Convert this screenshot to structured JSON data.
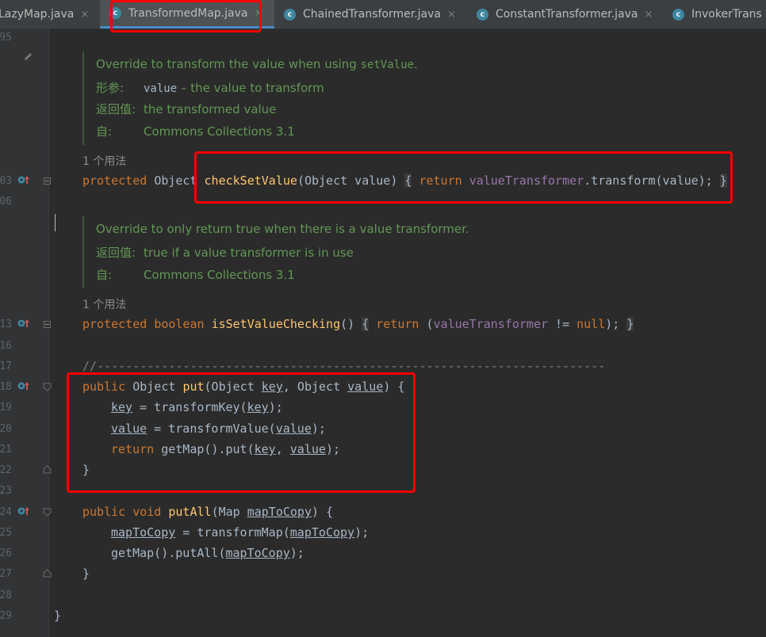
{
  "tabs": [
    {
      "label": "LazyMap.java",
      "icon": "class-icon",
      "active": false
    },
    {
      "label": "TransformedMap.java",
      "icon": "class-icon",
      "active": true
    },
    {
      "label": "ChainedTransformer.java",
      "icon": "class-icon",
      "active": false
    },
    {
      "label": "ConstantTransformer.java",
      "icon": "class-icon",
      "active": false
    },
    {
      "label": "InvokerTrans",
      "icon": "class-icon",
      "active": false
    }
  ],
  "tab_close_glyph": "×",
  "tab_class_glyph": "c",
  "line_numbers": {
    "l95": "95",
    "l103": "03",
    "l106": "06",
    "l113": "13",
    "l116": "16",
    "l117": "17",
    "l118": "18",
    "l119": "19",
    "l120": "20",
    "l121": "21",
    "l122": "22",
    "l123": "23",
    "l124": "24",
    "l125": "25",
    "l126": "26",
    "l127": "27",
    "l128": "28",
    "l129": "29"
  },
  "doc1": {
    "summary_prefix": "Override to transform the value when using ",
    "summary_code": "setValue",
    "summary_suffix": ".",
    "param_tag": "形参:",
    "param_name": "value",
    "param_desc": " – the value to transform",
    "return_tag": "返回值:",
    "return_desc": "the transformed value",
    "since_tag": "自:",
    "since_desc": "Commons Collections 3.1"
  },
  "doc2": {
    "summary": "Override to only return true when there is a value transformer.",
    "return_tag": "返回值:",
    "return_desc": "true if a value transformer is in use",
    "since_tag": "自:",
    "since_desc": "Commons Collections 3.1"
  },
  "usage_hint": "1 个用法",
  "code": {
    "checkSetValue": {
      "kw_protected": "protected",
      "type": "Object",
      "method": "checkSetValue",
      "params": "(Object value)",
      "open": "{",
      "kw_return": "return",
      "field": "valueTransformer",
      "call": ".transform(value);",
      "close": "}"
    },
    "isSetValueChecking": {
      "kw_protected": "protected",
      "kw_boolean": "boolean",
      "method": "isSetValueChecking",
      "parens": "()",
      "open": "{",
      "kw_return": "return",
      "paren_open": "(",
      "field": "valueTransformer",
      "op": " != ",
      "kw_null": "null",
      "tail": ");",
      "close": "}"
    },
    "separator": "//-----------------------------------------------------------------------",
    "put": {
      "kw_public": "public",
      "type": "Object",
      "method": "put",
      "p_open": "(Object ",
      "key": "key",
      "comma": ", Object ",
      "value": "value",
      "p_close": ") {",
      "l1_eq": " = transformKey(",
      "l1_end": ");",
      "l2_eq": " = transformValue(",
      "l2_end": ");",
      "kw_return": "return",
      "l3_call": " getMap().put(",
      "l3_sep": ", ",
      "l3_end": ");",
      "close": "}"
    },
    "putAll": {
      "kw_public": "public",
      "kw_void": "void",
      "method": "putAll",
      "p_open": "(Map ",
      "param": "mapToCopy",
      "p_close": ") {",
      "l1_eq": " = transformMap(",
      "l1_end": ");",
      "l2_call": "getMap().putAll(",
      "l2_end": ");",
      "close": "}"
    },
    "class_close": "}"
  },
  "colors": {
    "highlight": "#ff0000",
    "keyword": "#cc7832",
    "method": "#ffc66d",
    "field": "#9876aa",
    "doc": "#629755"
  }
}
